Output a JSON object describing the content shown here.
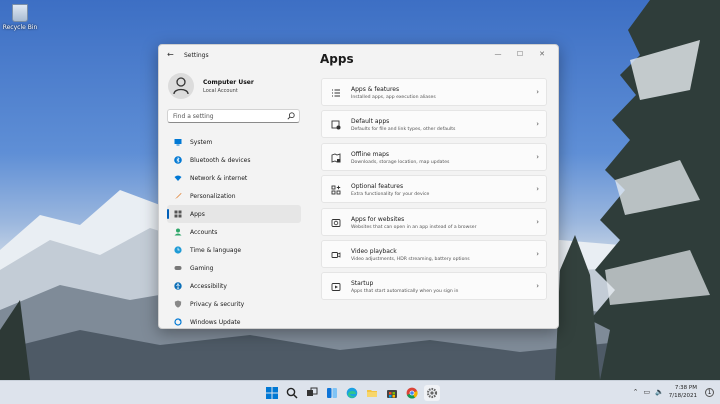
{
  "desktop": {
    "recycle_bin_label": "Recycle Bin"
  },
  "window": {
    "app_title": "Settings",
    "profile": {
      "name": "Computer User",
      "account_type": "Local Account"
    },
    "search": {
      "placeholder": "Find a setting"
    },
    "nav": [
      {
        "label": "System",
        "icon": "monitor-icon",
        "color": "#0078d4"
      },
      {
        "label": "Bluetooth & devices",
        "icon": "bluetooth-icon",
        "color": "#0078d4"
      },
      {
        "label": "Network & internet",
        "icon": "wifi-icon",
        "color": "#0078d4"
      },
      {
        "label": "Personalization",
        "icon": "brush-icon",
        "color": "#e07a26"
      },
      {
        "label": "Apps",
        "icon": "apps-icon",
        "color": "#555555",
        "active": true
      },
      {
        "label": "Accounts",
        "icon": "person-icon",
        "color": "#2fa66a"
      },
      {
        "label": "Time & language",
        "icon": "globe-clock-icon",
        "color": "#1f9bd6"
      },
      {
        "label": "Gaming",
        "icon": "gamepad-icon",
        "color": "#777777"
      },
      {
        "label": "Accessibility",
        "icon": "accessibility-icon",
        "color": "#0b6fb8"
      },
      {
        "label": "Privacy & security",
        "icon": "shield-icon",
        "color": "#888888"
      },
      {
        "label": "Windows Update",
        "icon": "update-icon",
        "color": "#0078d4"
      }
    ],
    "page_title": "Apps",
    "cards": [
      {
        "title": "Apps & features",
        "desc": "Installed apps, app execution aliases",
        "icon": "list-icon"
      },
      {
        "title": "Default apps",
        "desc": "Defaults for file and link types, other defaults",
        "icon": "default-apps-icon"
      },
      {
        "title": "Offline maps",
        "desc": "Downloads, storage location, map updates",
        "icon": "map-icon"
      },
      {
        "title": "Optional features",
        "desc": "Extra functionality for your device",
        "icon": "grid-plus-icon"
      },
      {
        "title": "Apps for websites",
        "desc": "Websites that can open in an app instead of a browser",
        "icon": "web-app-icon"
      },
      {
        "title": "Video playback",
        "desc": "Video adjustments, HDR streaming, battery options",
        "icon": "video-icon"
      },
      {
        "title": "Startup",
        "desc": "Apps that start automatically when you sign in",
        "icon": "startup-icon"
      }
    ]
  },
  "taskbar": {
    "time": "7:38 PM",
    "date": "7/18/2021"
  }
}
